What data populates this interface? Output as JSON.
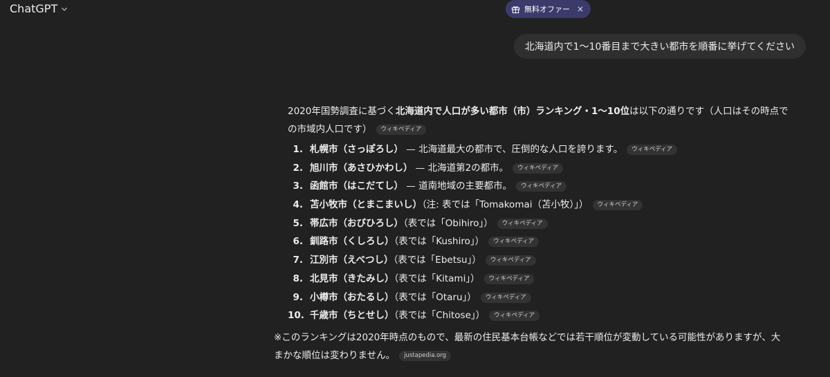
{
  "header": {
    "app_title": "ChatGPT",
    "offer_label": "無料オファー",
    "offer_close": "×"
  },
  "user_message": "北海道内で1〜10番目まで大きい都市を順番に挙げてください",
  "answer": {
    "intro_pre": "2020年国勢調査に基づく",
    "intro_bold": "北海道内で人口が多い都市（市）ランキング・1〜10位",
    "intro_post_line1": "は以下の通りです（人口はその時点で",
    "intro_line2": "の市域内人口です）",
    "intro_source": "ウィキペディア",
    "items": [
      {
        "num": "1.",
        "name": "札幌市（さっぽろし）",
        "desc": " — 北海道最大の都市で、圧倒的な人口を誇ります。",
        "source": "ウィキペディア"
      },
      {
        "num": "2.",
        "name": "旭川市（あさひかわし）",
        "desc": " — 北海道第2の都市。",
        "source": "ウィキペディア"
      },
      {
        "num": "3.",
        "name": "函館市（はこだてし）",
        "desc": " — 道南地域の主要都市。",
        "source": "ウィキペディア"
      },
      {
        "num": "4.",
        "name": "苫小牧市（とまこまいし）",
        "desc": "（注: 表では「Tomakomai（苫小牧）」）",
        "source": "ウィキペディア"
      },
      {
        "num": "5.",
        "name": "帯広市（おびひろし）",
        "desc": "（表では「Obihiro」）",
        "source": "ウィキペディア"
      },
      {
        "num": "6.",
        "name": "釧路市（くしろし）",
        "desc": "（表では「Kushiro」）",
        "source": "ウィキペディア"
      },
      {
        "num": "7.",
        "name": "江別市（えべつし）",
        "desc": "（表では「Ebetsu」）",
        "source": "ウィキペディア"
      },
      {
        "num": "8.",
        "name": "北見市（きたみし）",
        "desc": "（表では「Kitami」）",
        "source": "ウィキペディア"
      },
      {
        "num": "9.",
        "name": "小樽市（おたるし）",
        "desc": "（表では「Otaru」）",
        "source": "ウィキペディア"
      },
      {
        "num": "10.",
        "name": "千歳市（ちとせし）",
        "desc": "（表では「Chitose」）",
        "source": "ウィキペディア"
      }
    ],
    "note_line1": "※このランキングは2020年時点のもので、最新の住民基本台帳などでは若干順位が変動している可能性がありますが、大",
    "note_line2": "まかな順位は変わりません。",
    "note_source": "justapedia.org"
  },
  "colors": {
    "background": "#212121",
    "bubble": "#2f2f2f",
    "offer_pill": "#3b3a6b",
    "source_chip": "#333333"
  }
}
